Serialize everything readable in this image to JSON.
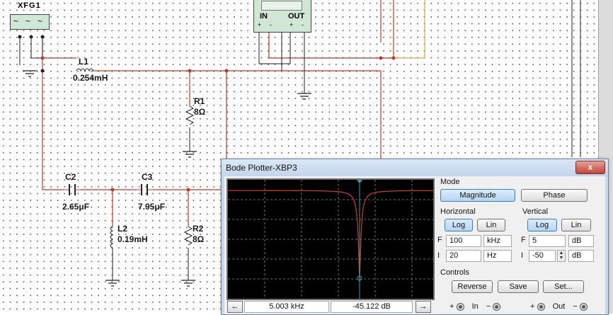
{
  "schematic": {
    "generator": {
      "name": "XFG1",
      "glyphs": [
        "~",
        "~",
        "~"
      ]
    },
    "bode_instrument": {
      "in_label": "IN",
      "out_label": "OUT",
      "signs": [
        "+",
        "-",
        "+",
        "-"
      ]
    },
    "components": {
      "l1": {
        "name": "L1",
        "value": "0.254mH"
      },
      "r1": {
        "name": "R1",
        "value": "8Ω"
      },
      "c2": {
        "name": "C2",
        "value": "2.65μF"
      },
      "c3": {
        "name": "C3",
        "value": "7.95μF"
      },
      "l2": {
        "name": "L2",
        "value": "0.19mH"
      },
      "r2": {
        "name": "R2",
        "value": "8Ω"
      }
    },
    "colors": {
      "wire_red": "#c0392b",
      "wire_orange": "#e8a33a",
      "wire_black": "#222222"
    }
  },
  "bode": {
    "title": "Bode Plotter-XBP3",
    "close_label": "x",
    "mode": {
      "label": "Mode",
      "magnitude_label": "Magnitude",
      "phase_label": "Phase",
      "selected": "Magnitude"
    },
    "horizontal": {
      "label": "Horizontal",
      "log_label": "Log",
      "lin_label": "Lin",
      "selected": "Log",
      "f_label": "F",
      "f_value": "100",
      "f_unit": "kHz",
      "i_label": "I",
      "i_value": "20",
      "i_unit": "Hz"
    },
    "vertical": {
      "label": "Vertical",
      "log_label": "Log",
      "lin_label": "Lin",
      "selected": "Log",
      "f_label": "F",
      "f_value": "5",
      "f_unit": "dB",
      "i_label": "I",
      "i_value": "-50",
      "i_unit": "dB"
    },
    "controls": {
      "label": "Controls",
      "reverse_label": "Reverse",
      "save_label": "Save",
      "set_label": "Set..."
    },
    "status": {
      "left_arrow": "←",
      "right_arrow": "→",
      "frequency": "5.003 kHz",
      "magnitude": "-45.122 dB"
    },
    "terminals": {
      "in_label": "In",
      "out_label": "Out",
      "plus": "+",
      "minus": "−"
    },
    "plot": {
      "trace_color": "#c0392b",
      "cursor_color": "#2fa4b0",
      "grid_color": "#8a8a8a"
    }
  }
}
